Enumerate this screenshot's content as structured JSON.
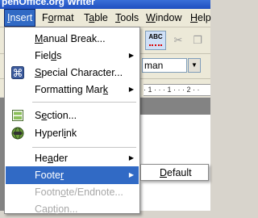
{
  "window": {
    "title": "penOffice.org Writer"
  },
  "menubar": {
    "items": [
      {
        "label": "Insert",
        "key": "I",
        "rest": "nsert"
      },
      {
        "label": "Format",
        "key": "o",
        "pre": "F",
        "rest": "rmat"
      },
      {
        "label": "Table",
        "key": "a",
        "pre": "T",
        "rest": "ble"
      },
      {
        "label": "Tools",
        "key": "T",
        "rest": "ools"
      },
      {
        "label": "Window",
        "key": "W",
        "rest": "indow"
      },
      {
        "label": "Help",
        "key": "H",
        "rest": "elp"
      }
    ]
  },
  "toolbar": {
    "font_name": "man"
  },
  "ruler": {
    "text": "· 1 · · · 1 · · · 2 · ·"
  },
  "insert_menu": {
    "items": [
      {
        "pre": "",
        "key": "M",
        "post": "anual Break..."
      },
      {
        "pre": "Fiel",
        "key": "d",
        "post": "s"
      },
      {
        "pre": "",
        "key": "S",
        "post": "pecial Character..."
      },
      {
        "pre": "Formatting Mar",
        "key": "k",
        "post": ""
      },
      {
        "pre": "S",
        "key": "e",
        "post": "ction..."
      },
      {
        "pre": "Hyperl",
        "key": "i",
        "post": "nk"
      },
      {
        "pre": "He",
        "key": "a",
        "post": "der"
      },
      {
        "pre": "Foote",
        "key": "r",
        "post": ""
      },
      {
        "pre": "Footn",
        "key": "o",
        "post": "te/Endnote..."
      },
      {
        "pre": "Capt",
        "key": "i",
        "post": "on..."
      }
    ]
  },
  "footer_submenu": {
    "items": [
      {
        "pre": "",
        "key": "D",
        "post": "efault"
      }
    ]
  }
}
